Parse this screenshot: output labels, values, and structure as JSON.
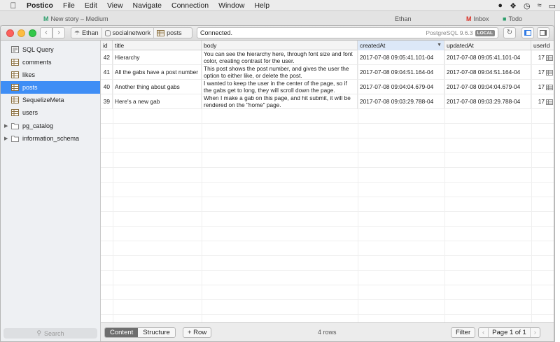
{
  "menubar": {
    "app": "Postico",
    "items": [
      "File",
      "Edit",
      "View",
      "Navigate",
      "Connection",
      "Window",
      "Help"
    ]
  },
  "background": {
    "tab1": "New story – Medium",
    "tab_user": "Ethan",
    "tab2": "Inbox",
    "tab3": "Todo"
  },
  "toolbar": {
    "breadcrumb": [
      {
        "label": "Ethan",
        "icon": "server-icon"
      },
      {
        "label": "socialnetwork",
        "icon": "database-icon"
      },
      {
        "label": "posts",
        "icon": "table-icon"
      }
    ],
    "status": "Connected.",
    "server_version": "PostgreSQL 9.6.3",
    "server_badge": "LOCAL"
  },
  "sidebar": {
    "items": [
      {
        "label": "SQL Query",
        "icon": "sql-query-icon"
      },
      {
        "label": "comments",
        "icon": "table-icon"
      },
      {
        "label": "likes",
        "icon": "table-icon"
      },
      {
        "label": "posts",
        "icon": "table-icon",
        "active": true
      },
      {
        "label": "SequelizeMeta",
        "icon": "table-icon"
      },
      {
        "label": "users",
        "icon": "table-icon"
      },
      {
        "label": "pg_catalog",
        "icon": "folder-icon",
        "expandable": true
      },
      {
        "label": "information_schema",
        "icon": "folder-icon",
        "expandable": true
      }
    ],
    "search_placeholder": "Search"
  },
  "table": {
    "columns": [
      "id",
      "title",
      "body",
      "createdAt",
      "updatedAt",
      "userId"
    ],
    "sorted_column": "createdAt",
    "rows": [
      {
        "id": "42",
        "title": "Hierarchy",
        "body": "You can see the hierarchy here, through font size and font color, creating contrast for the user.",
        "createdAt": "2017-07-08 09:05:41.101-04",
        "updatedAt": "2017-07-08 09:05:41.101-04",
        "userId": "17"
      },
      {
        "id": "41",
        "title": "All the gabs have a post number",
        "body": "This post shows the post number, and gives the user the option to either like, or delete the post.",
        "createdAt": "2017-07-08 09:04:51.164-04",
        "updatedAt": "2017-07-08 09:04:51.164-04",
        "userId": "17"
      },
      {
        "id": "40",
        "title": "Another thing about gabs",
        "body": "I wanted to keep the user in the center of the page, so if the gabs get to long, they will scroll down the page.",
        "createdAt": "2017-07-08 09:04:04.679-04",
        "updatedAt": "2017-07-08 09:04:04.679-04",
        "userId": "17"
      },
      {
        "id": "39",
        "title": "Here's a new gab",
        "body": "When I make a gab on this page, and hit submit, it will be rendered on the \"home\" page.",
        "createdAt": "2017-07-08 09:03:29.788-04",
        "updatedAt": "2017-07-08 09:03:29.788-04",
        "userId": "17"
      }
    ]
  },
  "bottombar": {
    "content_tab": "Content",
    "structure_tab": "Structure",
    "add_row": "+ Row",
    "row_count": "4 rows",
    "filter": "Filter",
    "page_label": "Page 1 of 1"
  },
  "colors": {
    "selection": "#3f8ef5",
    "sorted_header": "#dce8f8"
  }
}
